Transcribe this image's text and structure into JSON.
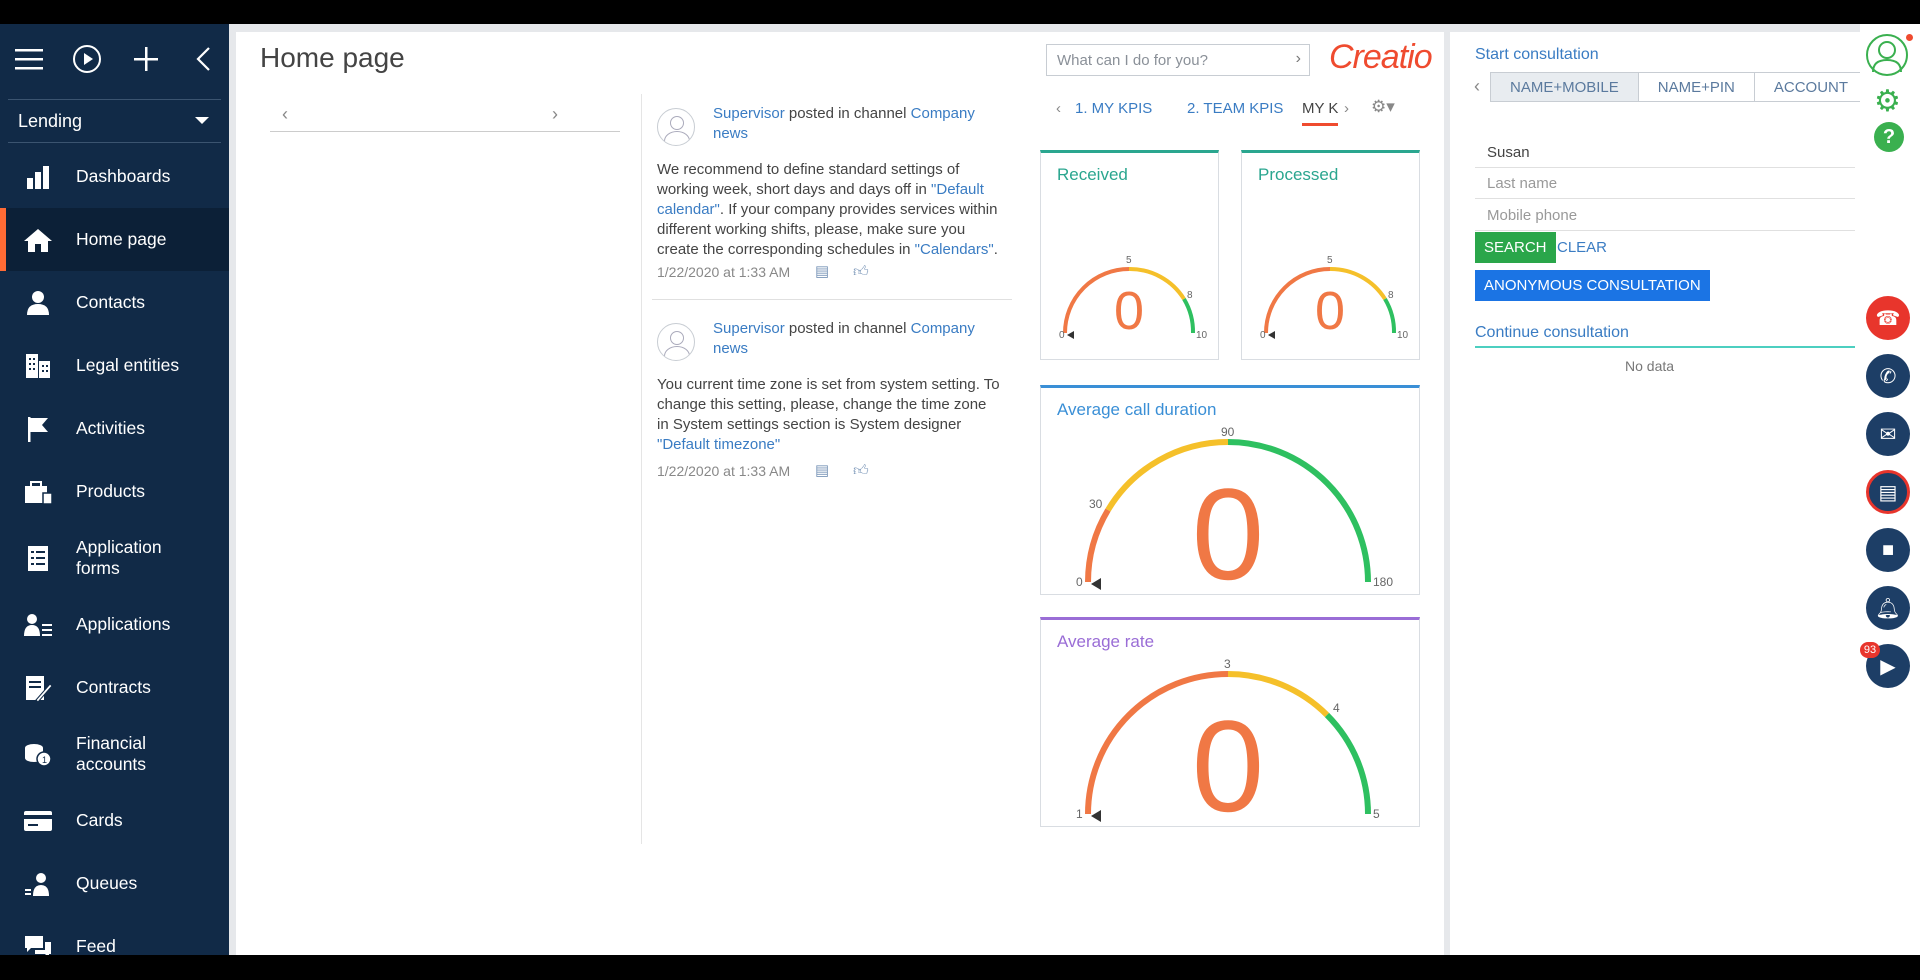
{
  "sidebar": {
    "workspace": "Lending",
    "items": [
      {
        "label": "Dashboards",
        "icon": "bar-chart-icon"
      },
      {
        "label": "Home page",
        "icon": "home-icon",
        "active": true
      },
      {
        "label": "Contacts",
        "icon": "person-icon"
      },
      {
        "label": "Legal entities",
        "icon": "building-icon"
      },
      {
        "label": "Activities",
        "icon": "flag-icon"
      },
      {
        "label": "Products",
        "icon": "briefcase-icon"
      },
      {
        "label": "Application forms",
        "icon": "form-icon"
      },
      {
        "label": "Applications",
        "icon": "person-list-icon"
      },
      {
        "label": "Contracts",
        "icon": "pen-doc-icon"
      },
      {
        "label": "Financial accounts",
        "icon": "coins-icon"
      },
      {
        "label": "Cards",
        "icon": "card-icon"
      },
      {
        "label": "Queues",
        "icon": "queue-icon"
      },
      {
        "label": "Feed",
        "icon": "chat-icon"
      }
    ]
  },
  "header": {
    "title": "Home page",
    "search_placeholder": "What can I do for you?",
    "logo": "Creatio"
  },
  "feed": {
    "posts": [
      {
        "author": "Supervisor",
        "action": "posted in channel",
        "channel": "Company news",
        "text_1": "We recommend to define standard settings of working week, short days and days off in ",
        "link_1": "\"Default calendar\"",
        "text_2": ". If your company provides services within different working shifts, please, make sure you create the corresponding schedules in ",
        "link_2": "\"Calendars\"",
        "text_3": ".",
        "timestamp": "1/22/2020 at 1:33 AM"
      },
      {
        "author": "Supervisor",
        "action": "posted in channel",
        "channel": "Company news",
        "text_1": "You current time zone is set from system setting. To change this setting, please, change the time zone in System settings section is System designer ",
        "link_1": "\"Default timezone\"",
        "timestamp": "1/22/2020 at 1:33 AM"
      }
    ]
  },
  "dashboard": {
    "tabs": [
      "1. MY KPIS",
      "2. TEAM KPIS",
      "MY K"
    ],
    "widgets": [
      {
        "title": "Received",
        "value": "0",
        "ticks": [
          "0",
          "5",
          "8",
          "10"
        ],
        "color": "#2aa68f"
      },
      {
        "title": "Processed",
        "value": "0",
        "ticks": [
          "0",
          "5",
          "8",
          "10"
        ],
        "color": "#2aa68f"
      },
      {
        "title": "Average call duration",
        "value": "0",
        "ticks": [
          "0",
          "30",
          "90",
          "180"
        ],
        "color": "#3a8fd6"
      },
      {
        "title": "Average rate",
        "value": "0",
        "ticks": [
          "1",
          "3",
          "4",
          "5"
        ],
        "color": "#9a6dd6"
      }
    ]
  },
  "consultation": {
    "title": "Start consultation",
    "tabs": [
      "NAME+MOBILE",
      "NAME+PIN",
      "ACCOUNT"
    ],
    "first_name": "Susan",
    "last_name_placeholder": "Last name",
    "mobile_placeholder": "Mobile phone",
    "search_label": "SEARCH",
    "clear_label": "CLEAR",
    "anon_label": "ANONYMOUS CONSULTATION",
    "continue_title": "Continue consultation",
    "no_data": "No data"
  },
  "comm": {
    "badge": "93"
  },
  "colors": {
    "sidebar_bg": "#112a47",
    "accent": "#ef4b2f",
    "link": "#3a7cc3",
    "search_btn": "#2aa64a",
    "anon_btn": "#1b74e4"
  }
}
